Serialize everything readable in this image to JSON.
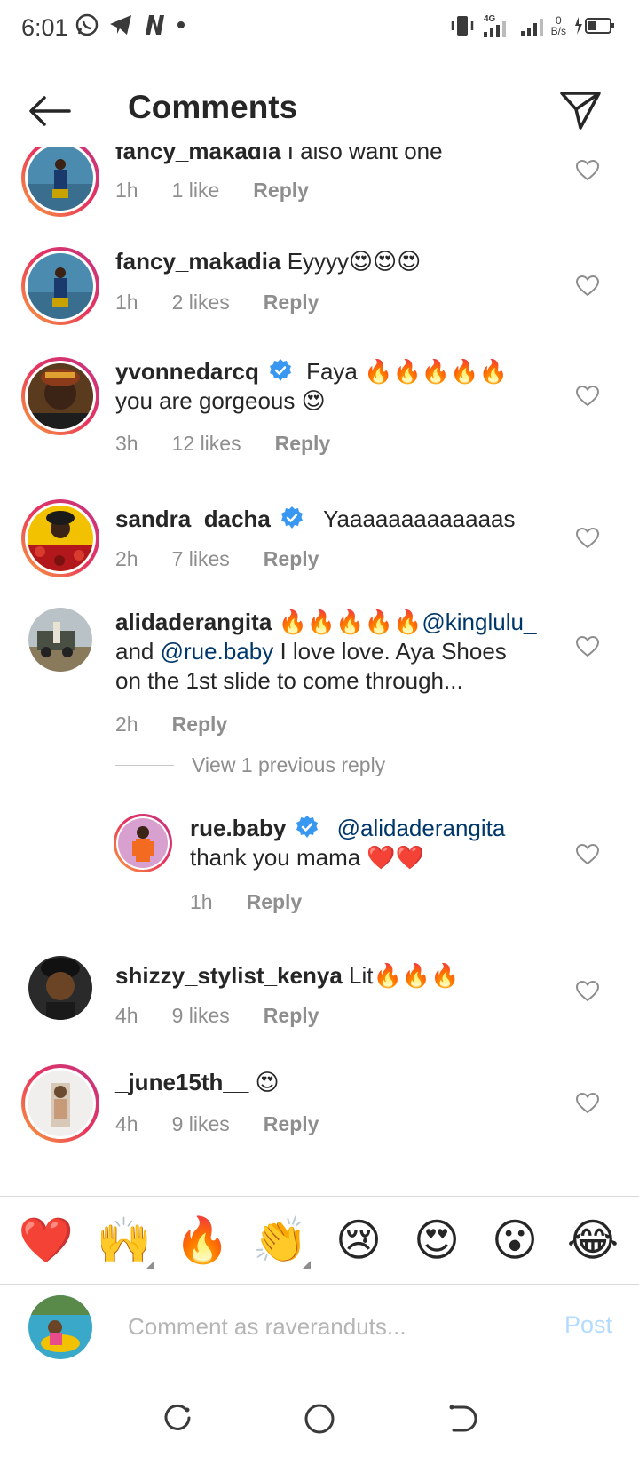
{
  "status": {
    "time": "6:01",
    "network": "4G",
    "speed_value": "0",
    "speed_unit": "B/s"
  },
  "header": {
    "title": "Comments"
  },
  "comments": [
    {
      "username": "fancy_makadia",
      "text": "I also want one",
      "time": "1h",
      "likes": "1 like",
      "reply": "Reply"
    },
    {
      "username": "fancy_makadia",
      "text": "Eyyyy😍😍😍",
      "time": "1h",
      "likes": "2 likes",
      "reply": "Reply"
    },
    {
      "username": "yvonnedarcq",
      "text": "Faya 🔥🔥🔥🔥🔥",
      "text2": "you are gorgeous 😍",
      "time": "3h",
      "likes": "12 likes",
      "reply": "Reply"
    },
    {
      "username": "sandra_dacha",
      "text": "Yaaaaaaaaaaaaas",
      "time": "2h",
      "likes": "7 likes",
      "reply": "Reply"
    },
    {
      "username": "alidaderangita",
      "text": "🔥🔥🔥🔥🔥",
      "mention1": "@kinglulu_",
      "and": "and",
      "mention2": "@rue.baby",
      "text2": "I love love. Aya Shoes",
      "text3": "on the 1st slide to come through...",
      "time": "2h",
      "reply": "Reply"
    },
    {
      "username": "shizzy_stylist_kenya",
      "text": "Lit🔥🔥🔥",
      "time": "4h",
      "likes": "9 likes",
      "reply": "Reply"
    },
    {
      "username": "_june15th__",
      "text": "😍",
      "time": "4h",
      "likes": "9 likes",
      "reply": "Reply"
    }
  ],
  "view_replies": "View 1 previous reply",
  "reply_item": {
    "username": "rue.baby",
    "mention": "@alidaderangita",
    "text": "thank you mama ❤️❤️",
    "time": "1h",
    "reply": "Reply"
  },
  "emoji_bar": [
    "❤️",
    "🙌",
    "🔥",
    "👏",
    "😢",
    "😍",
    "😮",
    "😂"
  ],
  "input": {
    "placeholder": "Comment as raveranduts...",
    "post_label": "Post"
  },
  "colors": {
    "mention": "#00376b",
    "meta": "#8e8e8e",
    "verified": "#3897f0",
    "post_disabled": "#b3dbff"
  }
}
